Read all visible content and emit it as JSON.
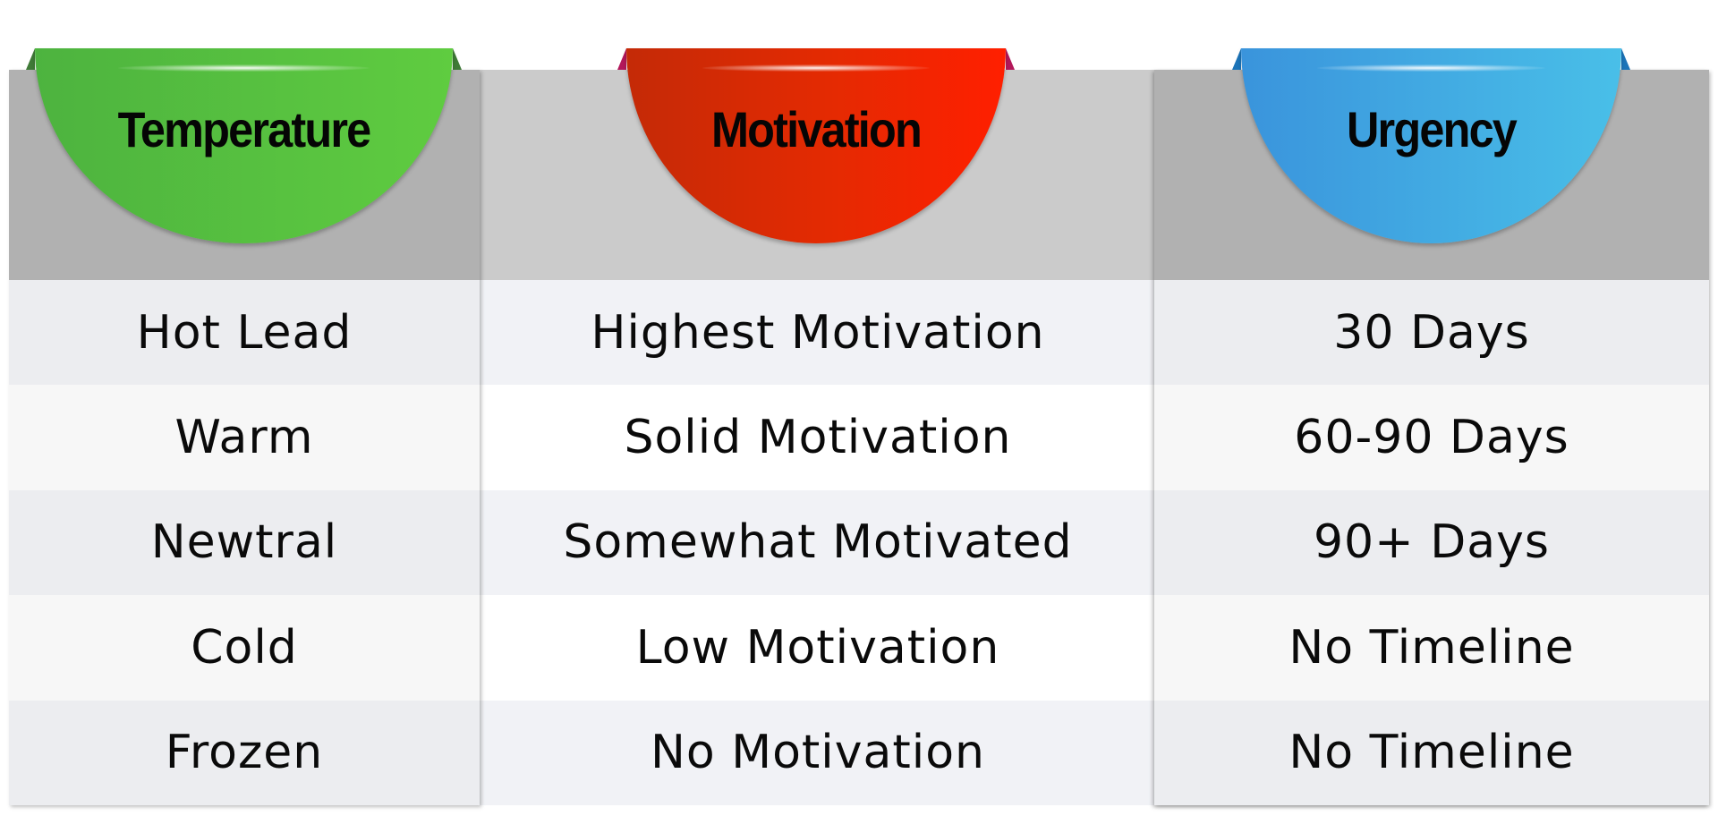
{
  "columns": [
    {
      "title": "Temperature",
      "color": "#5cc640",
      "items": [
        "Hot Lead",
        "Warm",
        "Newtral",
        "Cold",
        "Frozen"
      ]
    },
    {
      "title": "Motivation",
      "color": "#e52a02",
      "items": [
        "Highest Motivation",
        "Solid Motivation",
        "Somewhat Motivated",
        "Low Motivation",
        "No Motivation"
      ]
    },
    {
      "title": "Urgency",
      "color": "#45ace4",
      "items": [
        "30 Days",
        "60-90 Days",
        "90+ Days",
        "No Timeline",
        "No Timeline"
      ]
    }
  ]
}
